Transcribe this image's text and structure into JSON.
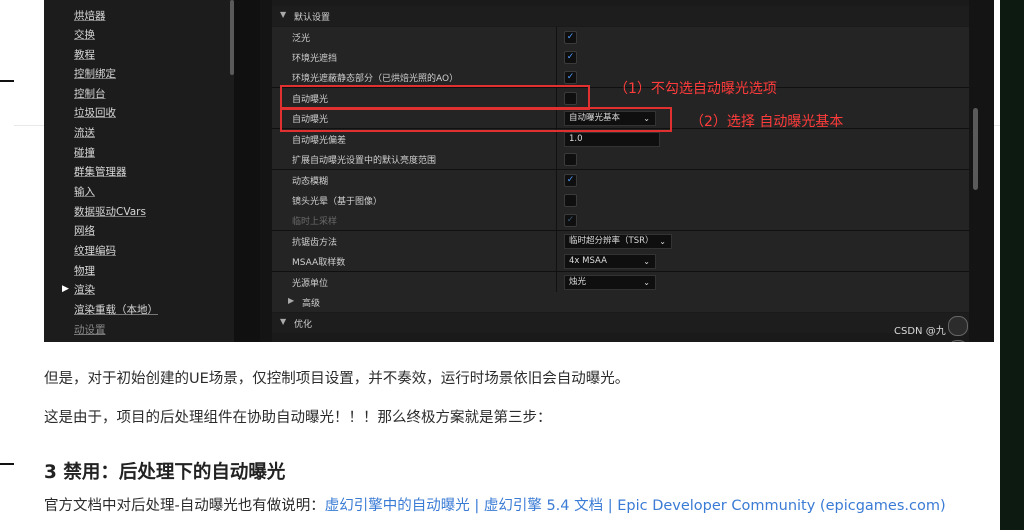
{
  "nav": {
    "items": [
      "烘焙器",
      "交换",
      "教程",
      "控制绑定",
      "控制台",
      "垃圾回收",
      "流送",
      "碰撞",
      "群集管理器",
      "输入",
      "数据驱动CVars",
      "网络",
      "纹理编码",
      "物理",
      "渲染",
      "渲染重载（本地）",
      "动设置"
    ],
    "active": "渲染"
  },
  "panel": {
    "section_default": "默认设置",
    "section_advanced": "高级",
    "section_optimize": "优化",
    "rows": {
      "bloom": "泛光",
      "ao": "环境光遮挡",
      "ao_static": "环境光遮蔽静态部分（已烘焙光照的AO）",
      "auto_exposure": "自动曝光",
      "auto_exposure_method": "自动曝光",
      "exposure_bias": "自动曝光偏差",
      "extend_range": "扩展自动曝光设置中的默认亮度范围",
      "motion_blur": "动态模糊",
      "lens_flare": "镜头光晕（基于图像）",
      "temporal_upsample": "临时上采样",
      "aa_method": "抗锯齿方法",
      "msaa": "MSAA取样数",
      "light_units": "光源单位"
    },
    "values": {
      "auto_exposure_method": "自动曝光基本",
      "exposure_bias": "1.0",
      "aa_method": "临时超分辨率（TSR）",
      "msaa": "4x MSAA",
      "light_units": "烛光"
    }
  },
  "annotations": {
    "step1": "（1）不勾选自动曝光选项",
    "step2": "（2）选择 自动曝光基本"
  },
  "watermark": "CSDN @九",
  "article": {
    "p1": "但是，对于初始创建的UE场景，仅控制项目设置，并不奏效，运行时场景依旧会自动曝光。",
    "p2": "这是由于，项目的后处理组件在协助自动曝光！！！那么终极方案就是第三步：",
    "heading": "3 禁用：后处理下的自动曝光",
    "desc_prefix": "官方文档中对后处理-自动曝光也有做说明：",
    "desc_link": "虚幻引擎中的自动曝光 | 虚幻引擎 5.4 文档 | Epic Developer Community (epicgames.com)"
  },
  "colors": {
    "accent_red": "#e03030",
    "link": "#3a7bd5",
    "check": "#4d9bff"
  },
  "icons": [
    "checkbox-checked-icon",
    "chevron-down-icon",
    "triangle-expand-icon",
    "triangle-right-icon"
  ]
}
